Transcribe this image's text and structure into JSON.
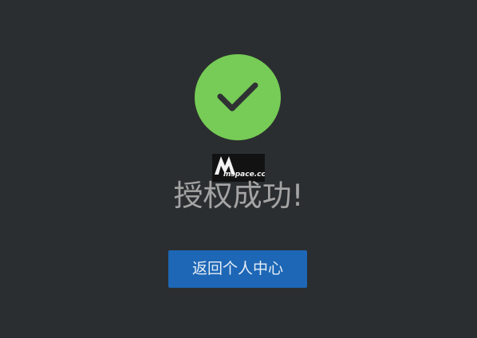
{
  "status": {
    "icon": "checkmark-icon",
    "color": "#76cc56",
    "title": "授权成功!"
  },
  "watermark": {
    "text": "mspace.cc"
  },
  "actions": {
    "back_label": "返回个人中心",
    "button_color": "#1d67b6"
  }
}
